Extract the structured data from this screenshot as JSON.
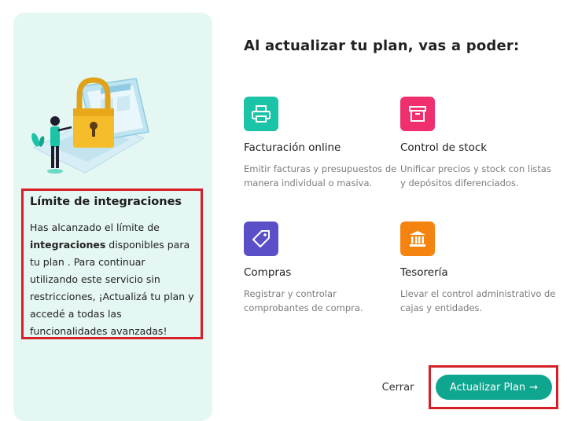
{
  "colors": {
    "panel_bg": "#e4f7f3",
    "highlight_border": "#d61f26",
    "primary": "#0fa690",
    "invoicing_icon_bg": "#1bc3a7",
    "stock_icon_bg": "#f0306e",
    "purchases_icon_bg": "#5b4fc8",
    "treasury_icon_bg": "#f5830f"
  },
  "limit_panel": {
    "title": "Límite de integraciones",
    "text_before": "Has alcanzado el límite de ",
    "text_bold": "integraciones",
    "text_after": " disponibles para tu plan . Para continuar utilizando este servicio sin restricciones, ¡Actualizá tu plan y accedé a todas las funcionalidades avanzadas!"
  },
  "main": {
    "heading": "Al actualizar tu plan, vas a poder:",
    "features": [
      {
        "icon": "printer-icon",
        "title": "Facturación online",
        "description": "Emitir facturas y presupuestos de manera individual o masiva."
      },
      {
        "icon": "box-icon",
        "title": "Control de stock",
        "description": "Unificar precios y stock con listas y depósitos diferenciados."
      },
      {
        "icon": "tag-icon",
        "title": "Compras",
        "description": "Registrar y controlar comprobantes de compra."
      },
      {
        "icon": "bank-icon",
        "title": "Tesorería",
        "description": "Llevar el control administrativo de cajas y entidades."
      }
    ]
  },
  "footer": {
    "cancel_label": "Cerrar",
    "upgrade_label": "Actualizar Plan",
    "upgrade_arrow": "→"
  }
}
